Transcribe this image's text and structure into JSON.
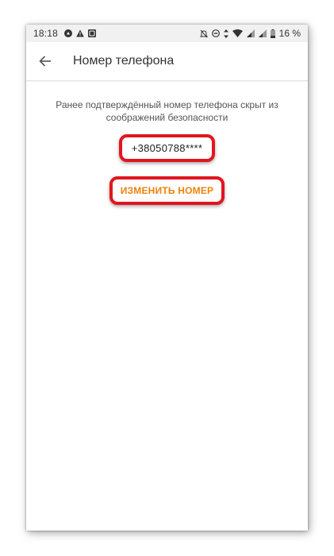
{
  "status_bar": {
    "time": "18:18",
    "battery": "16 %",
    "left_icons": [
      "android-icon",
      "warning-icon",
      "app-icon"
    ],
    "right_icons": [
      "mute-icon",
      "dnd-icon",
      "data-icon",
      "wifi-icon",
      "signal-icon",
      "signal-icon",
      "battery-icon"
    ]
  },
  "app_bar": {
    "back_icon": "arrow-left-icon",
    "title": "Номер телефона"
  },
  "main": {
    "description": "Ранее подтверждённый номер телефона скрыт из соображений безопасности",
    "masked_phone": "+38050788****",
    "change_button": "ИЗМЕНИТЬ НОМЕР"
  },
  "colors": {
    "accent": "#ee8208",
    "highlight": "#e3151e",
    "status_bar_bg": "#f1f1f1"
  }
}
